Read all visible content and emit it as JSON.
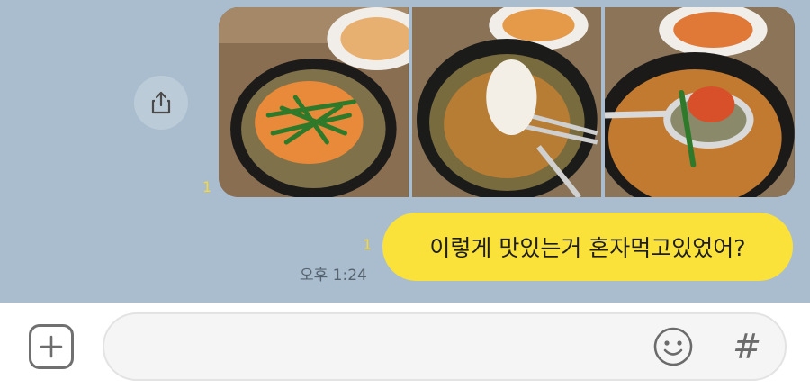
{
  "chat": {
    "photos_read_count": "1",
    "message_read_count": "1",
    "message_text": "이렇게 맛있는거 혼자먹고있었어?",
    "timestamp": "오후 1:24",
    "bubble_color": "#fbe23a",
    "background_color": "#a9bdce"
  },
  "photos": [
    {
      "name": "soup-photo-1",
      "subject": "stew-with-chives"
    },
    {
      "name": "soup-photo-2",
      "subject": "noodles-lifted-with-chopsticks"
    },
    {
      "name": "soup-photo-3",
      "subject": "spoon-with-kimchi"
    }
  ],
  "icons": {
    "share": "share-icon",
    "plus": "plus-icon",
    "emoji": "emoji-icon",
    "hashtag": "#"
  },
  "input": {
    "value": "",
    "placeholder": ""
  }
}
